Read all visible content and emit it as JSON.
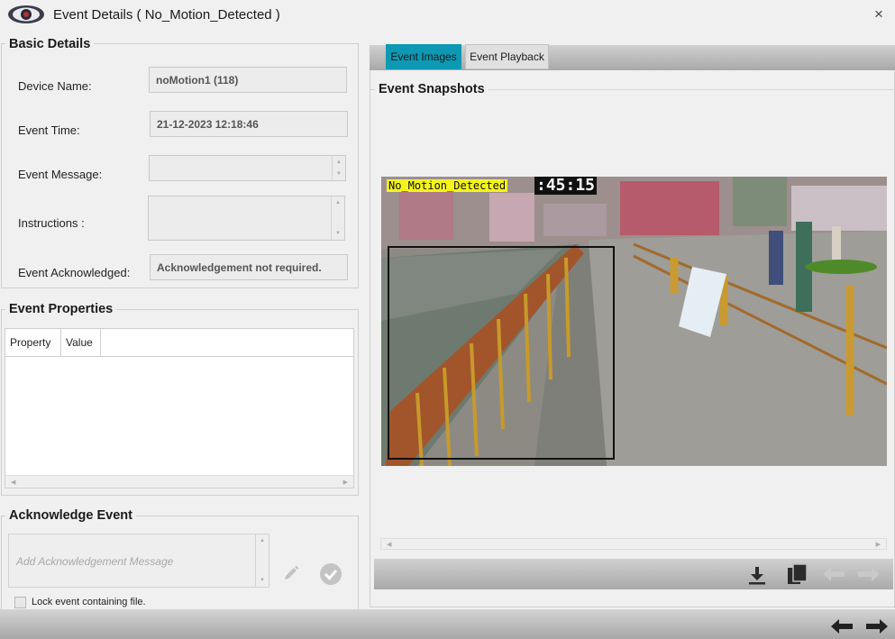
{
  "window": {
    "title": "Event Details ( No_Motion_Detected )",
    "close_glyph": "×"
  },
  "basic_details": {
    "heading": "Basic Details",
    "device_name_label": "Device Name:",
    "device_name_value": "noMotion1 (118)",
    "event_time_label": "Event Time:",
    "event_time_value": "21-12-2023 12:18:46",
    "event_message_label": "Event Message:",
    "event_message_value": "",
    "instructions_label": "Instructions :",
    "instructions_value": "",
    "event_ack_label": "Event Acknowledged:",
    "event_ack_value": "Acknowledgement not required."
  },
  "event_properties": {
    "heading": "Event Properties",
    "columns": [
      "Property",
      "Value"
    ],
    "rows": []
  },
  "acknowledge": {
    "heading": "Acknowledge Event",
    "message_placeholder": "Add Acknowledgement Message",
    "lock_label": "Lock event containing file.",
    "lock_checked": false
  },
  "tabs": [
    {
      "label": "Event Images",
      "active": true
    },
    {
      "label": "Event Playback",
      "active": false
    }
  ],
  "snapshots": {
    "heading": "Event Snapshots",
    "overlay_event_text": "No_Motion_Detected",
    "overlay_time_text": ":45:15"
  },
  "icons": {
    "app": "eye-icon",
    "download": "download-icon",
    "copy": "copy-icon",
    "prev": "arrow-left-icon",
    "next": "arrow-right-icon",
    "edit": "pencil-icon",
    "confirm": "check-circle-icon"
  },
  "colors": {
    "active_tab": "#0d98b3",
    "overlay_label_bg": "#f4f31d"
  }
}
